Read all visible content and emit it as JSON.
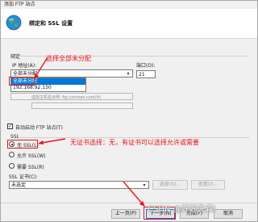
{
  "window_title": "添加 FTP 站点",
  "header_title": "绑定和 SSL 设置",
  "binding": {
    "group_title": "绑定",
    "ip_label": "IP 地址(A):",
    "ip_value": "全部未分配",
    "ip_options": [
      "全部未分配",
      "192.168.92.150"
    ],
    "port_label": "端口(O):",
    "port_value": "21",
    "host_hint": "虚拟主机名示例: ftp.contoso.com(H)"
  },
  "auto_start": {
    "label": "自动启动 FTP 站点(T)",
    "checked": true
  },
  "ssl": {
    "group_title": "SSL",
    "options": [
      "无 SSL(L)",
      "允许 SSL(W)",
      "需要 SSL(R)"
    ],
    "selected_index": 0,
    "cert_label": "SSL 证书(C):",
    "cert_value": "未选定",
    "select_button": "选择(S)...",
    "view_button": "查看(I)..."
  },
  "footer": {
    "prev": "上一页(P)",
    "next": "下一步(N)",
    "finish": "完成(F)",
    "cancel": "取消"
  },
  "annotations": {
    "ip_note": "选择全部未分配",
    "ssl_note": "无证书选择：无，有证书可以选择允许或需要"
  },
  "watermark": "CSDN @好好先森i",
  "colors": {
    "annotation": "#e8141c",
    "selection": "#0078d7"
  }
}
